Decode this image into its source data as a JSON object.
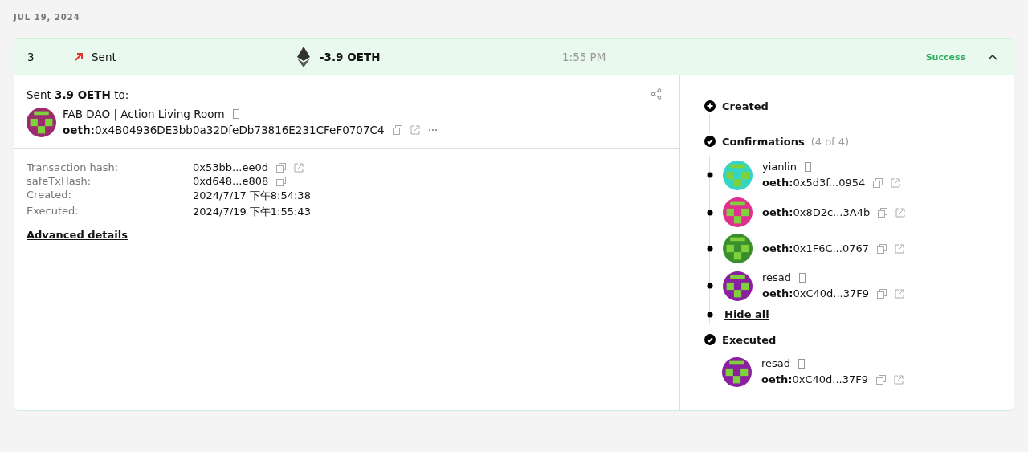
{
  "date_header": "JUL 19, 2024",
  "transaction": {
    "nonce": "3",
    "type_label": "Sent",
    "amount": "-3.9 OETH",
    "time": "1:55 PM",
    "status": "Success",
    "expanded": true
  },
  "recipient": {
    "summary": "Sent **3.9 OETH** to:",
    "name": "FAB DAO | Action Living Room",
    "address": "**oeth:**0x4B04936DE3bb0a32DfeDb73816E231CFeF0707C4",
    "color": "#9c2a6e"
  },
  "details": [
    {
      "label": "Transaction hash:",
      "value": "0x53bb...ee0d",
      "actions": [
        {
          "kind": "copy"
        },
        {
          "kind": "link"
        }
      ]
    },
    {
      "label": "safeTxHash:",
      "value": "0xd648...e808",
      "actions": [
        {
          "kind": "copy"
        }
      ]
    },
    {
      "label": "Created:",
      "value": "2024/7/17 下午8:54:38"
    },
    {
      "label": "Executed:",
      "value": "2024/7/19 下午1:55:43"
    }
  ],
  "advanced_link": "Advanced details",
  "timeline": {
    "created": "Created",
    "confirmations": "Confirmations",
    "confirmations_count": "(4 of 4)",
    "signers": [
      {
        "name": "yianlin",
        "address": "**oeth:**0x5d3f...0954",
        "color": "#33d6c4"
      },
      {
        "address": "**oeth:**0x8D2c...3A4b",
        "color": "#e0308f"
      },
      {
        "address": "**oeth:**0x1F6C...0767",
        "color": "#3a8f2c"
      },
      {
        "name": "resad",
        "address": "**oeth:**0xC40d...37F9",
        "color": "#8a1fa0"
      }
    ],
    "hide_all": "Hide all",
    "executed": "Executed",
    "executor": {
      "name": "resad",
      "address": "**oeth:**0xC40d...37F9",
      "color": "#8a1fa0"
    }
  }
}
